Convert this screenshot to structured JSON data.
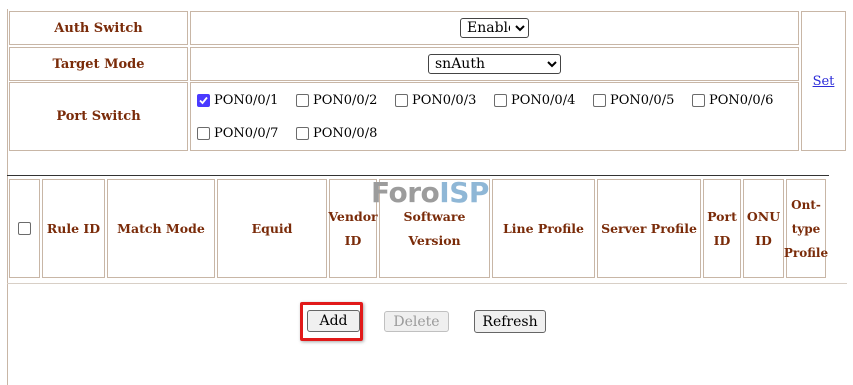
{
  "config": {
    "auth_switch": {
      "label": "Auth Switch",
      "value": "Enable"
    },
    "target_mode": {
      "label": "Target Mode",
      "value": "snAuth"
    },
    "port_switch": {
      "label": "Port Switch",
      "ports": [
        {
          "name": "PON0/0/1",
          "checked": true
        },
        {
          "name": "PON0/0/2",
          "checked": false
        },
        {
          "name": "PON0/0/3",
          "checked": false
        },
        {
          "name": "PON0/0/4",
          "checked": false
        },
        {
          "name": "PON0/0/5",
          "checked": false
        },
        {
          "name": "PON0/0/6",
          "checked": false
        },
        {
          "name": "PON0/0/7",
          "checked": false
        },
        {
          "name": "PON0/0/8",
          "checked": false
        }
      ]
    },
    "set_link": "Set"
  },
  "rules_table": {
    "headers": {
      "rule_id": "Rule ID",
      "match_mode": "Match Mode",
      "equid": "Equid",
      "vendor_id_1": "Vendor",
      "vendor_id_2": "ID",
      "software_version": "Software Version",
      "line_profile": "Line Profile",
      "server_profile": "Server Profile",
      "port_id_1": "Port",
      "port_id_2": "ID",
      "onu_id_1": "ONU",
      "onu_id_2": "ID",
      "ont_type_1": "Ont-",
      "ont_type_2": "type",
      "ont_type_3": "Profile"
    }
  },
  "actions": {
    "add": "Add",
    "delete": "Delete",
    "refresh": "Refresh"
  },
  "watermark": {
    "part1": "Foro",
    "part2": "ISP"
  },
  "colors": {
    "label": "#7a2b09",
    "border": "#c8b6a6",
    "link": "#2b2bd9",
    "highlight": "#e11919",
    "checkbox_checked": "#4a3aff"
  }
}
